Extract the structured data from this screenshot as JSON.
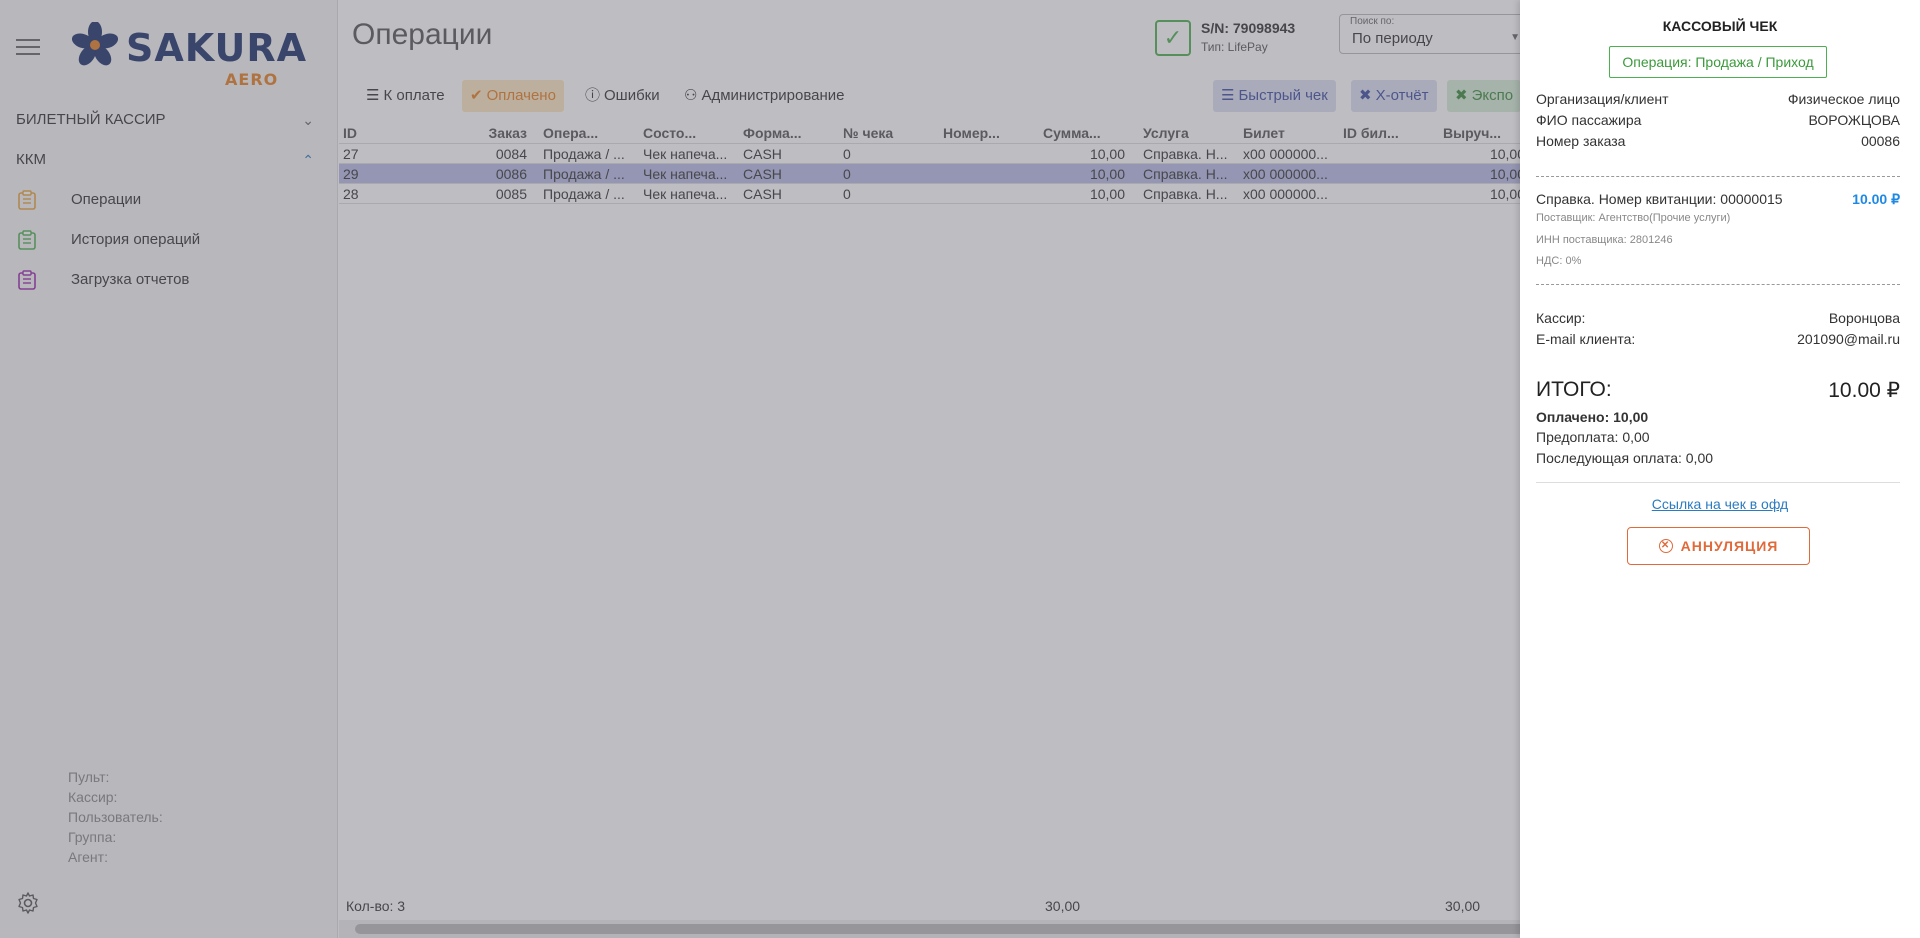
{
  "sidebar": {
    "logo_text": "SAKURA",
    "logo_sub": "AERO",
    "sections": [
      {
        "label": "БИЛЕТНЫЙ КАССИР",
        "chevron": "v"
      },
      {
        "label": "ККМ",
        "chevron": "^"
      }
    ],
    "items": [
      {
        "label": "Операции"
      },
      {
        "label": "История операций"
      },
      {
        "label": "Загрузка отчетов"
      }
    ],
    "info": [
      "Пульт:",
      "Кассир:",
      "Пользователь:",
      "Группа:",
      "Агент:"
    ]
  },
  "header": {
    "title": "Операции",
    "sn": "S/N: 79098943",
    "type": "Тип: LifePay",
    "search_label": "Поиск по:",
    "search_value": "По периоду"
  },
  "toolbar": {
    "to_pay": "К оплате",
    "paid": "Оплачено",
    "errors": "Ошибки",
    "admin": "Администрирование",
    "fast_check": "Быстрый чек",
    "x_report": "X-отчёт",
    "export": "Экспо"
  },
  "table": {
    "headers": [
      "ID",
      "Заказ",
      "Опера...",
      "Состо...",
      "Форма...",
      "№ чека",
      "Номер...",
      "Сумма...",
      "Услуга",
      "Билет",
      "ID бил...",
      "Выруч..."
    ],
    "rows": [
      [
        "27",
        "0084",
        "Продажа / ...",
        "Чек напеча...",
        "CASH",
        "0",
        "",
        "10,00",
        "Справка. Н...",
        "x00 000000...",
        "",
        "10,00"
      ],
      [
        "29",
        "0086",
        "Продажа / ...",
        "Чек напеча...",
        "CASH",
        "0",
        "",
        "10,00",
        "Справка. Н...",
        "x00 000000...",
        "",
        "10,00"
      ],
      [
        "28",
        "0085",
        "Продажа / ...",
        "Чек напеча...",
        "CASH",
        "0",
        "",
        "10,00",
        "Справка. Н...",
        "x00 000000...",
        "",
        "10,00"
      ]
    ],
    "footer_count": "Кол-во: 3",
    "footer_sum": "30,00",
    "footer_rev": "30,00"
  },
  "receipt": {
    "title": "КАССОВЫЙ ЧЕК",
    "operation": "Операция: Продажа / Приход",
    "org_label": "Организация/клиент",
    "org_value": "Физическое лицо",
    "fio_label": "ФИО пассажира",
    "fio_value": "ВОРОЖЦОВА",
    "order_label": "Номер заказа",
    "order_value": "00086",
    "service": "Справка. Номер квитанции: 00000015",
    "service_price": "10.00 ₽",
    "supplier": "Поставщик: Агентство(Прочие услуги)",
    "inn": "ИНН поставщика: 2801246",
    "vat": "НДС: 0%",
    "cashier_label": "Кассир:",
    "cashier_value": "Воронцова",
    "email_label": "E-mail клиента:",
    "email_value": "201090@mail.ru",
    "total_label": "ИТОГО:",
    "total_value": "10.00 ₽",
    "paid_label": "Оплачено: 10,00",
    "prepay": "Предоплата: 0,00",
    "postpay": "Последующая оплата: 0,00",
    "ofd_link": "Ссылка на чек в офд",
    "annul": "АННУЛЯЦИЯ"
  },
  "colors": {
    "brand": "#1a2f6a",
    "accent_orange": "#e67e22",
    "green": "#4caf50",
    "blue_link": "#2b7bc0"
  }
}
